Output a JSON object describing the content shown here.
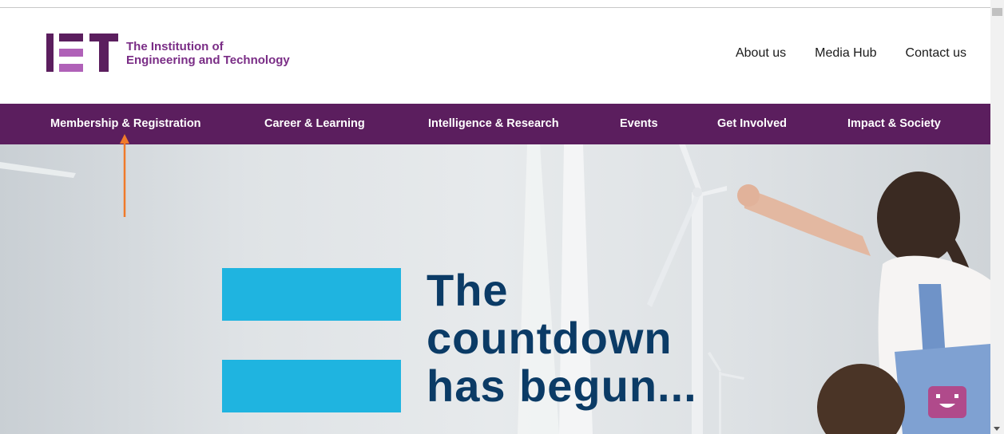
{
  "header": {
    "logo_line1": "The Institution of",
    "logo_line2": "Engineering and Technology",
    "utility_links": [
      "About us",
      "Media Hub",
      "Contact us"
    ]
  },
  "nav": {
    "items": [
      "Membership & Registration",
      "Career & Learning",
      "Intelligence & Research",
      "Events",
      "Get Involved",
      "Impact & Society"
    ]
  },
  "hero": {
    "headline": [
      "The",
      "countdown",
      "has begun..."
    ]
  },
  "colors": {
    "brand_purple": "#5b1e5e",
    "logo_purple": "#7a2d86",
    "logo_bar_light": "#b061b8",
    "equals_blue": "#1fb4e0",
    "headline_navy": "#0b3b66",
    "annotation_arrow": "#f07a2a",
    "chat_button": "#b04a8b"
  },
  "icons": {
    "chat": "chat-face-icon",
    "annotation": "arrow-up-icon"
  }
}
